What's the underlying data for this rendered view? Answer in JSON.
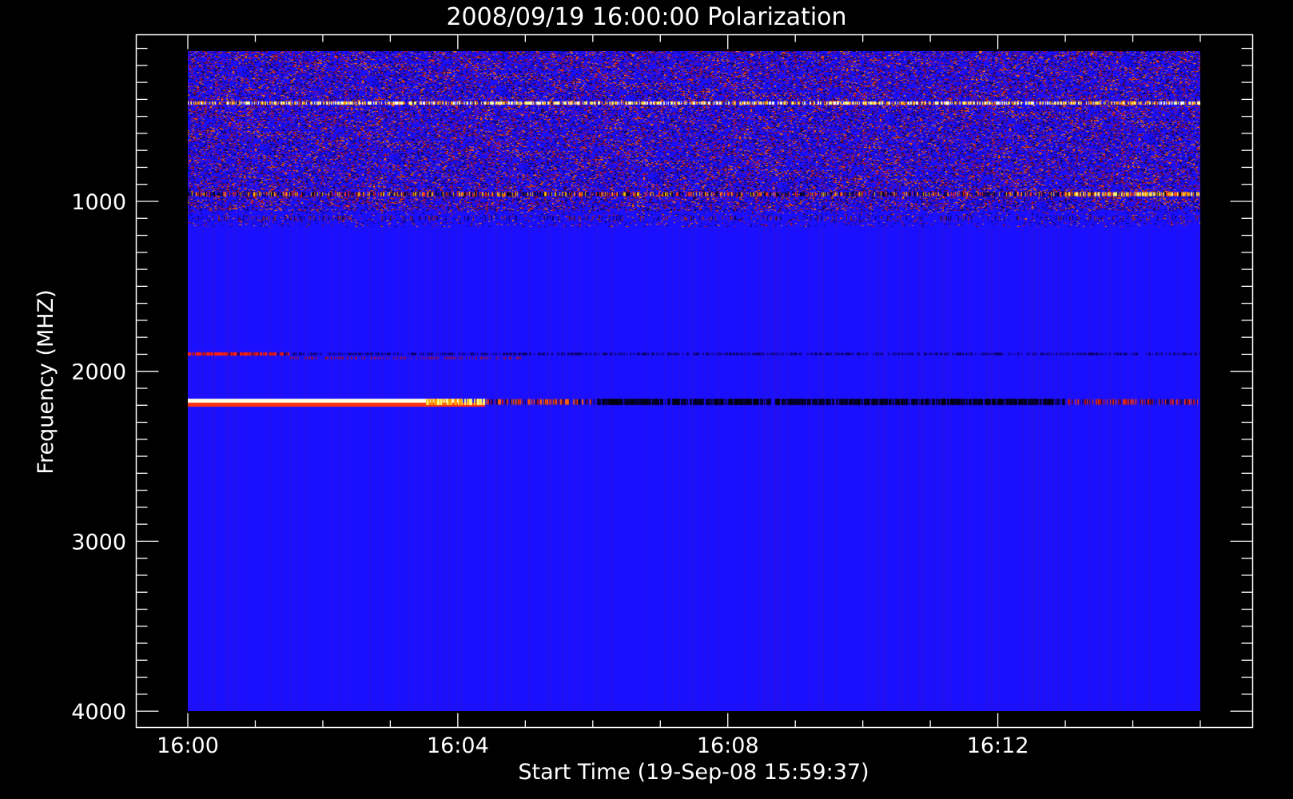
{
  "chart_data": {
    "type": "heatmap",
    "title": "2008/09/19 16:00:00 Polarization",
    "xlabel": "Start Time (19-Sep-08 15:59:37)",
    "ylabel": "Frequency (MHZ)",
    "x_range_minutes_after_1600": [
      0,
      15
    ],
    "x_major_ticks": [
      {
        "minute": 0,
        "label": "16:00"
      },
      {
        "minute": 4,
        "label": "16:04"
      },
      {
        "minute": 8,
        "label": "16:08"
      },
      {
        "minute": 12,
        "label": "16:12"
      }
    ],
    "y_range_mhz": [
      0,
      4000
    ],
    "y_axis_inverted": true,
    "y_major_ticks": [
      {
        "value": 1000,
        "label": "1000"
      },
      {
        "value": 2000,
        "label": "2000"
      },
      {
        "value": 3000,
        "label": "3000"
      },
      {
        "value": 4000,
        "label": "4000"
      }
    ],
    "data_extent": {
      "freq_mhz": [
        100,
        4000
      ],
      "minutes": [
        0,
        15
      ]
    },
    "colormap": [
      "#000000",
      "#1a10ff",
      "#cc1010",
      "#ff8a00",
      "#ffff80"
    ],
    "background_color": "#1a10ff",
    "features": [
      {
        "description": "bright yellow/white emission band",
        "freq_mhz": 2180,
        "minutes": [
          0,
          4.4
        ],
        "level": "high"
      },
      {
        "description": "red band continuing",
        "freq_mhz": 2190,
        "minutes": [
          4.4,
          6
        ],
        "level": "medium"
      },
      {
        "description": "dark band",
        "freq_mhz": 2180,
        "minutes": [
          6,
          13
        ],
        "level": "low"
      },
      {
        "description": "red band",
        "freq_mhz": 2180,
        "minutes": [
          13,
          15
        ],
        "level": "medium"
      },
      {
        "description": "speckled band",
        "freq_mhz": 960,
        "minutes": [
          0,
          15
        ],
        "level": "mixed"
      },
      {
        "description": "yellow speckled band",
        "freq_mhz": 420,
        "minutes": [
          0,
          15
        ],
        "level": "high"
      },
      {
        "description": "red line",
        "freq_mhz": 1900,
        "minutes": [
          0,
          1.5
        ],
        "level": "medium"
      }
    ]
  }
}
